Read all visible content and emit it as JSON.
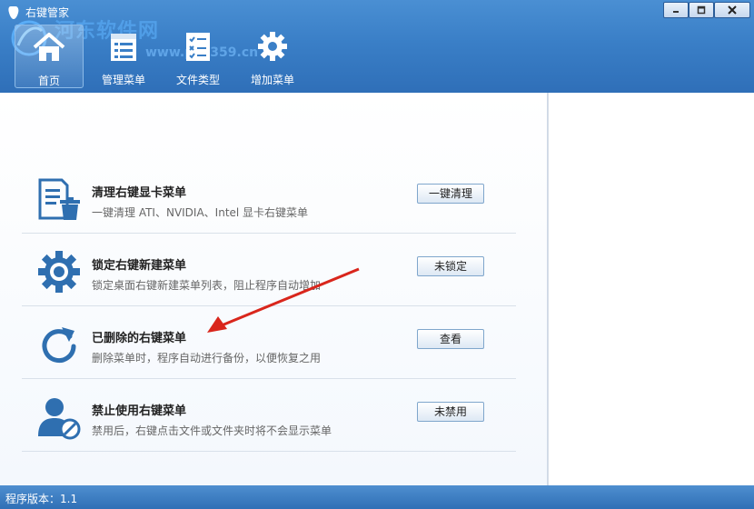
{
  "window": {
    "title": "右键管家",
    "controls": [
      "minimize-icon",
      "restore-icon",
      "close-icon"
    ]
  },
  "watermark": {
    "text": "河东软件网",
    "url": "www.pc0359.cn"
  },
  "nav": [
    {
      "label": "首页",
      "icon": "home-icon",
      "active": true
    },
    {
      "label": "管理菜单",
      "icon": "list-icon",
      "active": false
    },
    {
      "label": "文件类型",
      "icon": "checklist-icon",
      "active": false
    },
    {
      "label": "增加菜单",
      "icon": "gear-icon",
      "active": false
    }
  ],
  "features": [
    {
      "title": "清理右键显卡菜单",
      "desc": "一键清理 ATI、NVIDIA、Intel 显卡右键菜单",
      "button": "一键清理",
      "icon": "document-trash-icon"
    },
    {
      "title": "锁定右键新建菜单",
      "desc": "锁定桌面右键新建菜单列表，阻止程序自动增加",
      "button": "未锁定",
      "icon": "gear-icon"
    },
    {
      "title": "已删除的右键菜单",
      "desc": "删除菜单时，程序自动进行备份，以便恢复之用",
      "button": "查看",
      "icon": "refresh-icon"
    },
    {
      "title": "禁止使用右键菜单",
      "desc": "禁用后，右键点击文件或文件夹时将不会显示菜单",
      "button": "未禁用",
      "icon": "user-block-icon"
    }
  ],
  "status": {
    "version_text": "程序版本：1.1"
  },
  "colors": {
    "header": "#3a7fc7",
    "icon_blue": "#2f6fb0",
    "arrow_red": "#d9261c"
  }
}
